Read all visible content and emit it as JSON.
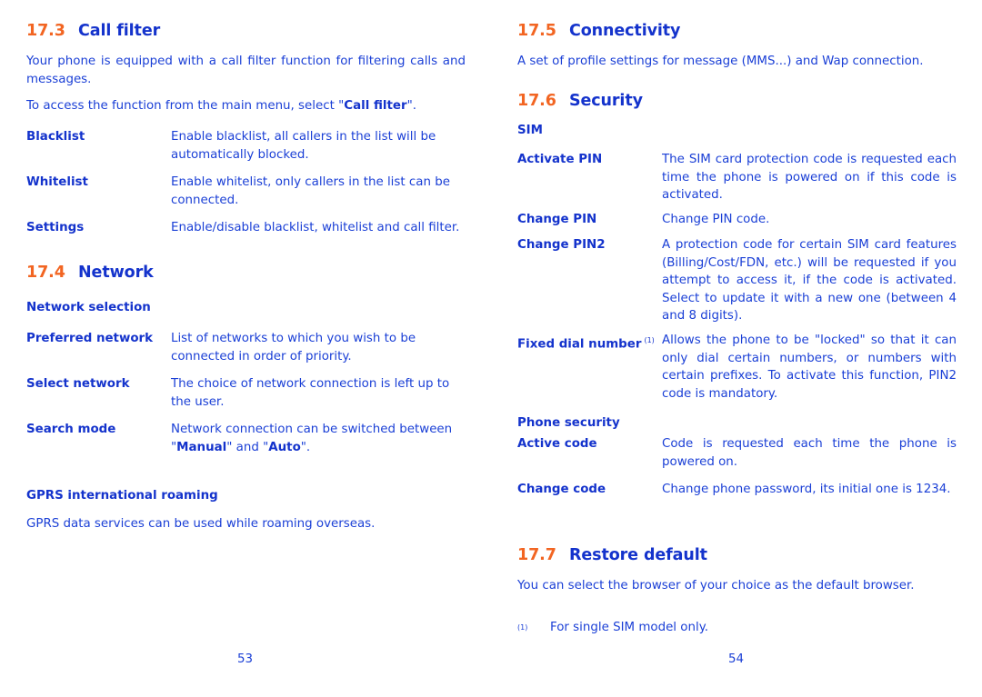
{
  "left_page": {
    "page_number": "53",
    "sections": {
      "call_filter": {
        "number": "17.3",
        "title": "Call filter",
        "intro": "Your phone is equipped with a call filter function for filtering calls and messages.",
        "access_prefix": "To access the function from the main menu, select \"",
        "access_bold": "Call filter",
        "access_suffix": "\".",
        "items": [
          {
            "term": "Blacklist",
            "definition": "Enable blacklist, all callers in the list will be automatically blocked."
          },
          {
            "term": "Whitelist",
            "definition": "Enable whitelist, only callers in the list can be connected."
          },
          {
            "term": "Settings",
            "definition": "Enable/disable blacklist, whitelist and call filter."
          }
        ]
      },
      "network": {
        "number": "17.4",
        "title": "Network",
        "subheading": "Network selection",
        "items": [
          {
            "term": "Preferred network",
            "definition": "List of networks to which you wish to be connected in order of priority."
          },
          {
            "term": "Select network",
            "definition": "The choice of network connection is left up to the user."
          },
          {
            "term": "Search mode",
            "definition_prefix": "Network connection can be switched between \"",
            "bold1": "Manual",
            "middle": "\" and \"",
            "bold2": "Auto",
            "definition_suffix": "\"."
          }
        ],
        "gprs_heading": "GPRS international roaming",
        "gprs_text": "GPRS data services can be used while roaming overseas."
      }
    }
  },
  "right_page": {
    "page_number": "54",
    "sections": {
      "connectivity": {
        "number": "17.5",
        "title": "Connectivity",
        "text": "A set of profile settings for message (MMS...) and Wap connection."
      },
      "security": {
        "number": "17.6",
        "title": "Security",
        "sim_heading": "SIM",
        "sim_items": [
          {
            "term": "Activate PIN",
            "definition": "The SIM card protection code is requested each time the phone is powered on if this code is activated."
          },
          {
            "term": "Change PIN",
            "definition": "Change PIN code."
          },
          {
            "term": "Change PIN2",
            "definition": "A protection code for certain SIM card features (Billing/Cost/FDN, etc.) will be requested if you attempt to access it, if the code is activated. Select to update it with a new one (between 4 and 8 digits)."
          },
          {
            "term": "Fixed dial number",
            "footnote_ref": "(1)",
            "definition": "Allows the phone to be \"locked\" so that it can only dial certain numbers, or numbers with certain prefixes. To activate this function, PIN2 code is mandatory."
          }
        ],
        "phone_heading": "Phone security",
        "phone_items": [
          {
            "term": "Active code",
            "definition": "Code is requested each time the phone is powered on."
          },
          {
            "term": "Change code",
            "definition": "Change phone password, its initial one is 1234."
          }
        ]
      },
      "restore_default": {
        "number": "17.7",
        "title": "Restore default",
        "text": "You can select the browser of your choice as the default browser."
      }
    },
    "footnote": {
      "mark": "(1)",
      "text": "For single SIM model only."
    }
  },
  "colors": {
    "section_number": "#f26522",
    "heading": "#1433cc",
    "body_text": "#1a3fd6"
  }
}
